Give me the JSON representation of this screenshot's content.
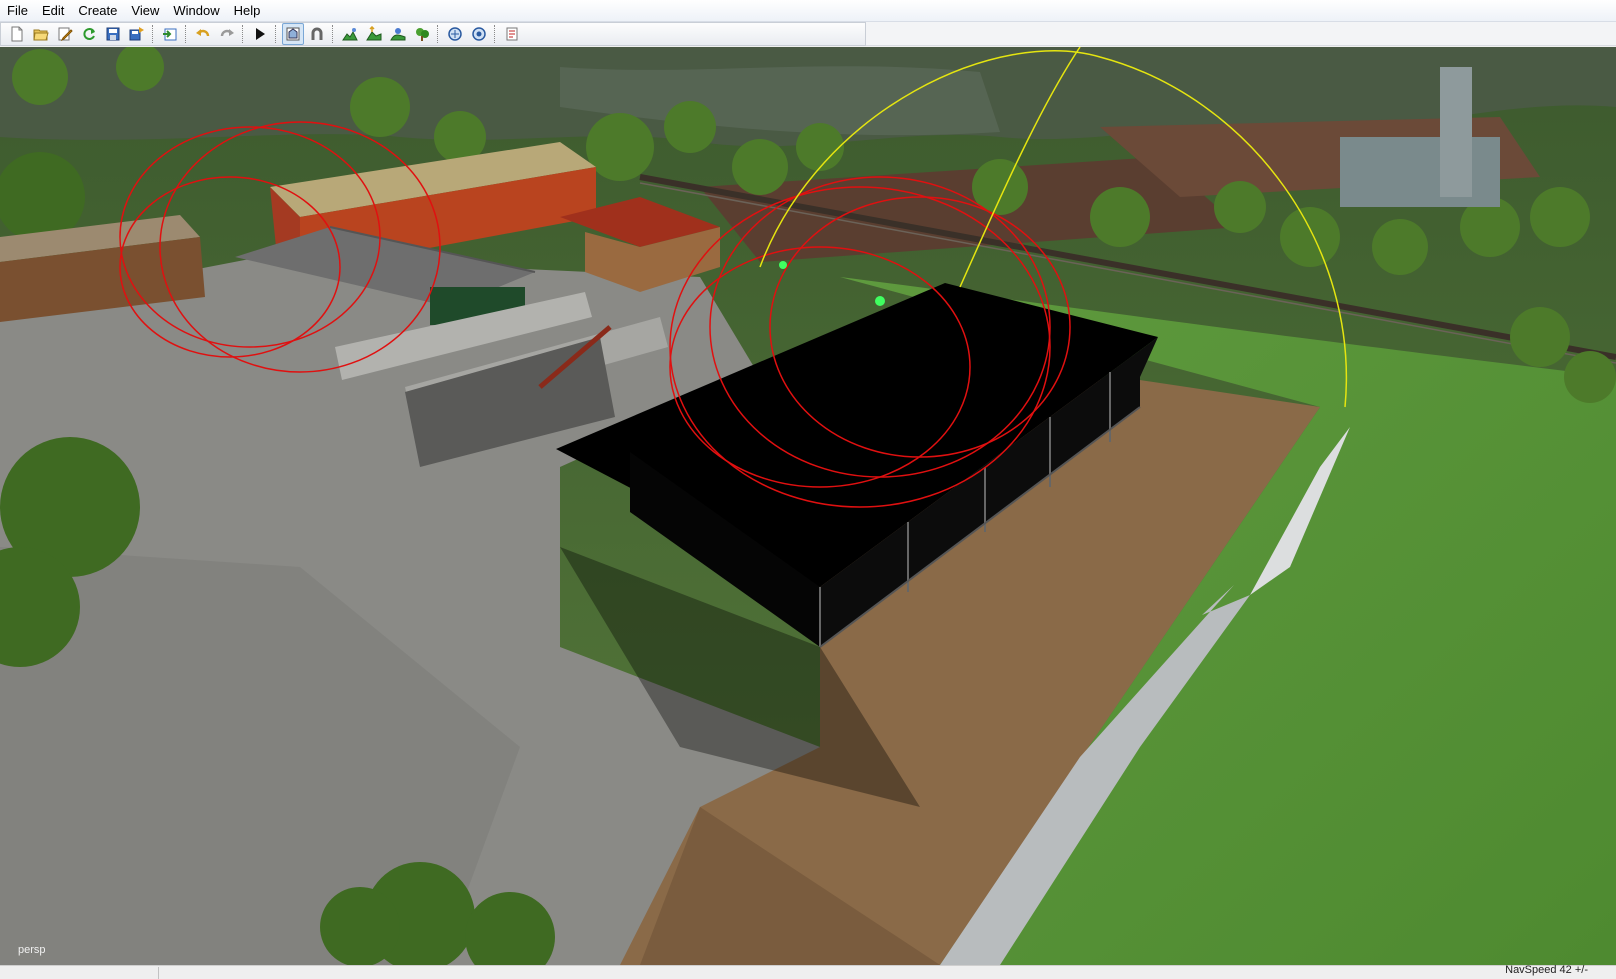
{
  "menu": {
    "items": [
      {
        "label": "File"
      },
      {
        "label": "Edit"
      },
      {
        "label": "Create"
      },
      {
        "label": "View"
      },
      {
        "label": "Window"
      },
      {
        "label": "Help"
      }
    ]
  },
  "toolbar": {
    "buttons": [
      {
        "icon": "new-icon"
      },
      {
        "icon": "open-icon"
      },
      {
        "icon": "edit-icon"
      },
      {
        "icon": "refresh-icon"
      },
      {
        "icon": "save-icon"
      },
      {
        "icon": "save-as-icon"
      },
      {
        "icon": "import-icon"
      },
      {
        "icon": "undo-icon"
      },
      {
        "icon": "redo-icon"
      },
      {
        "icon": "play-icon"
      },
      {
        "icon": "camera-icon",
        "active": true
      },
      {
        "icon": "magnet-icon"
      },
      {
        "icon": "terrain-paint-icon"
      },
      {
        "icon": "terrain-raise-icon"
      },
      {
        "icon": "terrain-smooth-icon"
      },
      {
        "icon": "foliage-icon"
      },
      {
        "icon": "rotate-icon"
      },
      {
        "icon": "settings-icon"
      },
      {
        "icon": "script-icon"
      }
    ]
  },
  "viewport": {
    "label": "persp"
  },
  "status": {
    "text": "NavSpeed 42 +/-"
  },
  "colors": {
    "grass": "#4f8a34",
    "gravel": "#8a8a86",
    "dirt": "#8a6a48",
    "light_ring": "#e01010",
    "selection_ring": "#e5e510",
    "barn_selected": "#000000"
  }
}
